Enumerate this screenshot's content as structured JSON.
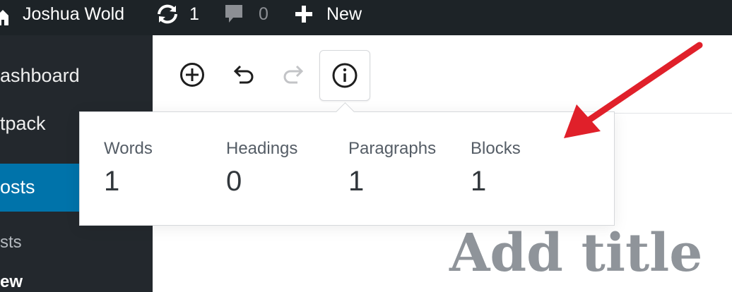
{
  "adminbar": {
    "site_name": "Joshua Wold",
    "updates_count": "1",
    "comments_count": "0",
    "new_label": "New"
  },
  "sidebar": {
    "items": [
      {
        "label": "ashboard"
      },
      {
        "label": "tpack"
      },
      {
        "label": "osts"
      },
      {
        "label": "sts"
      },
      {
        "label": "ew"
      }
    ]
  },
  "toolbar": {
    "add_block_icon": "plus-circle-icon",
    "undo_icon": "undo-icon",
    "redo_icon": "redo-icon",
    "info_icon": "info-icon"
  },
  "stats_popover": {
    "stats": [
      {
        "label": "Words",
        "value": "1"
      },
      {
        "label": "Headings",
        "value": "0"
      },
      {
        "label": "Paragraphs",
        "value": "1"
      },
      {
        "label": "Blocks",
        "value": "1"
      }
    ]
  },
  "editor": {
    "title_placeholder": "Add title"
  },
  "colors": {
    "adminbar_bg": "#1d2327",
    "sidebar_bg": "#23282d",
    "sidebar_active": "#0073aa",
    "annotation_arrow": "#e0202a"
  }
}
